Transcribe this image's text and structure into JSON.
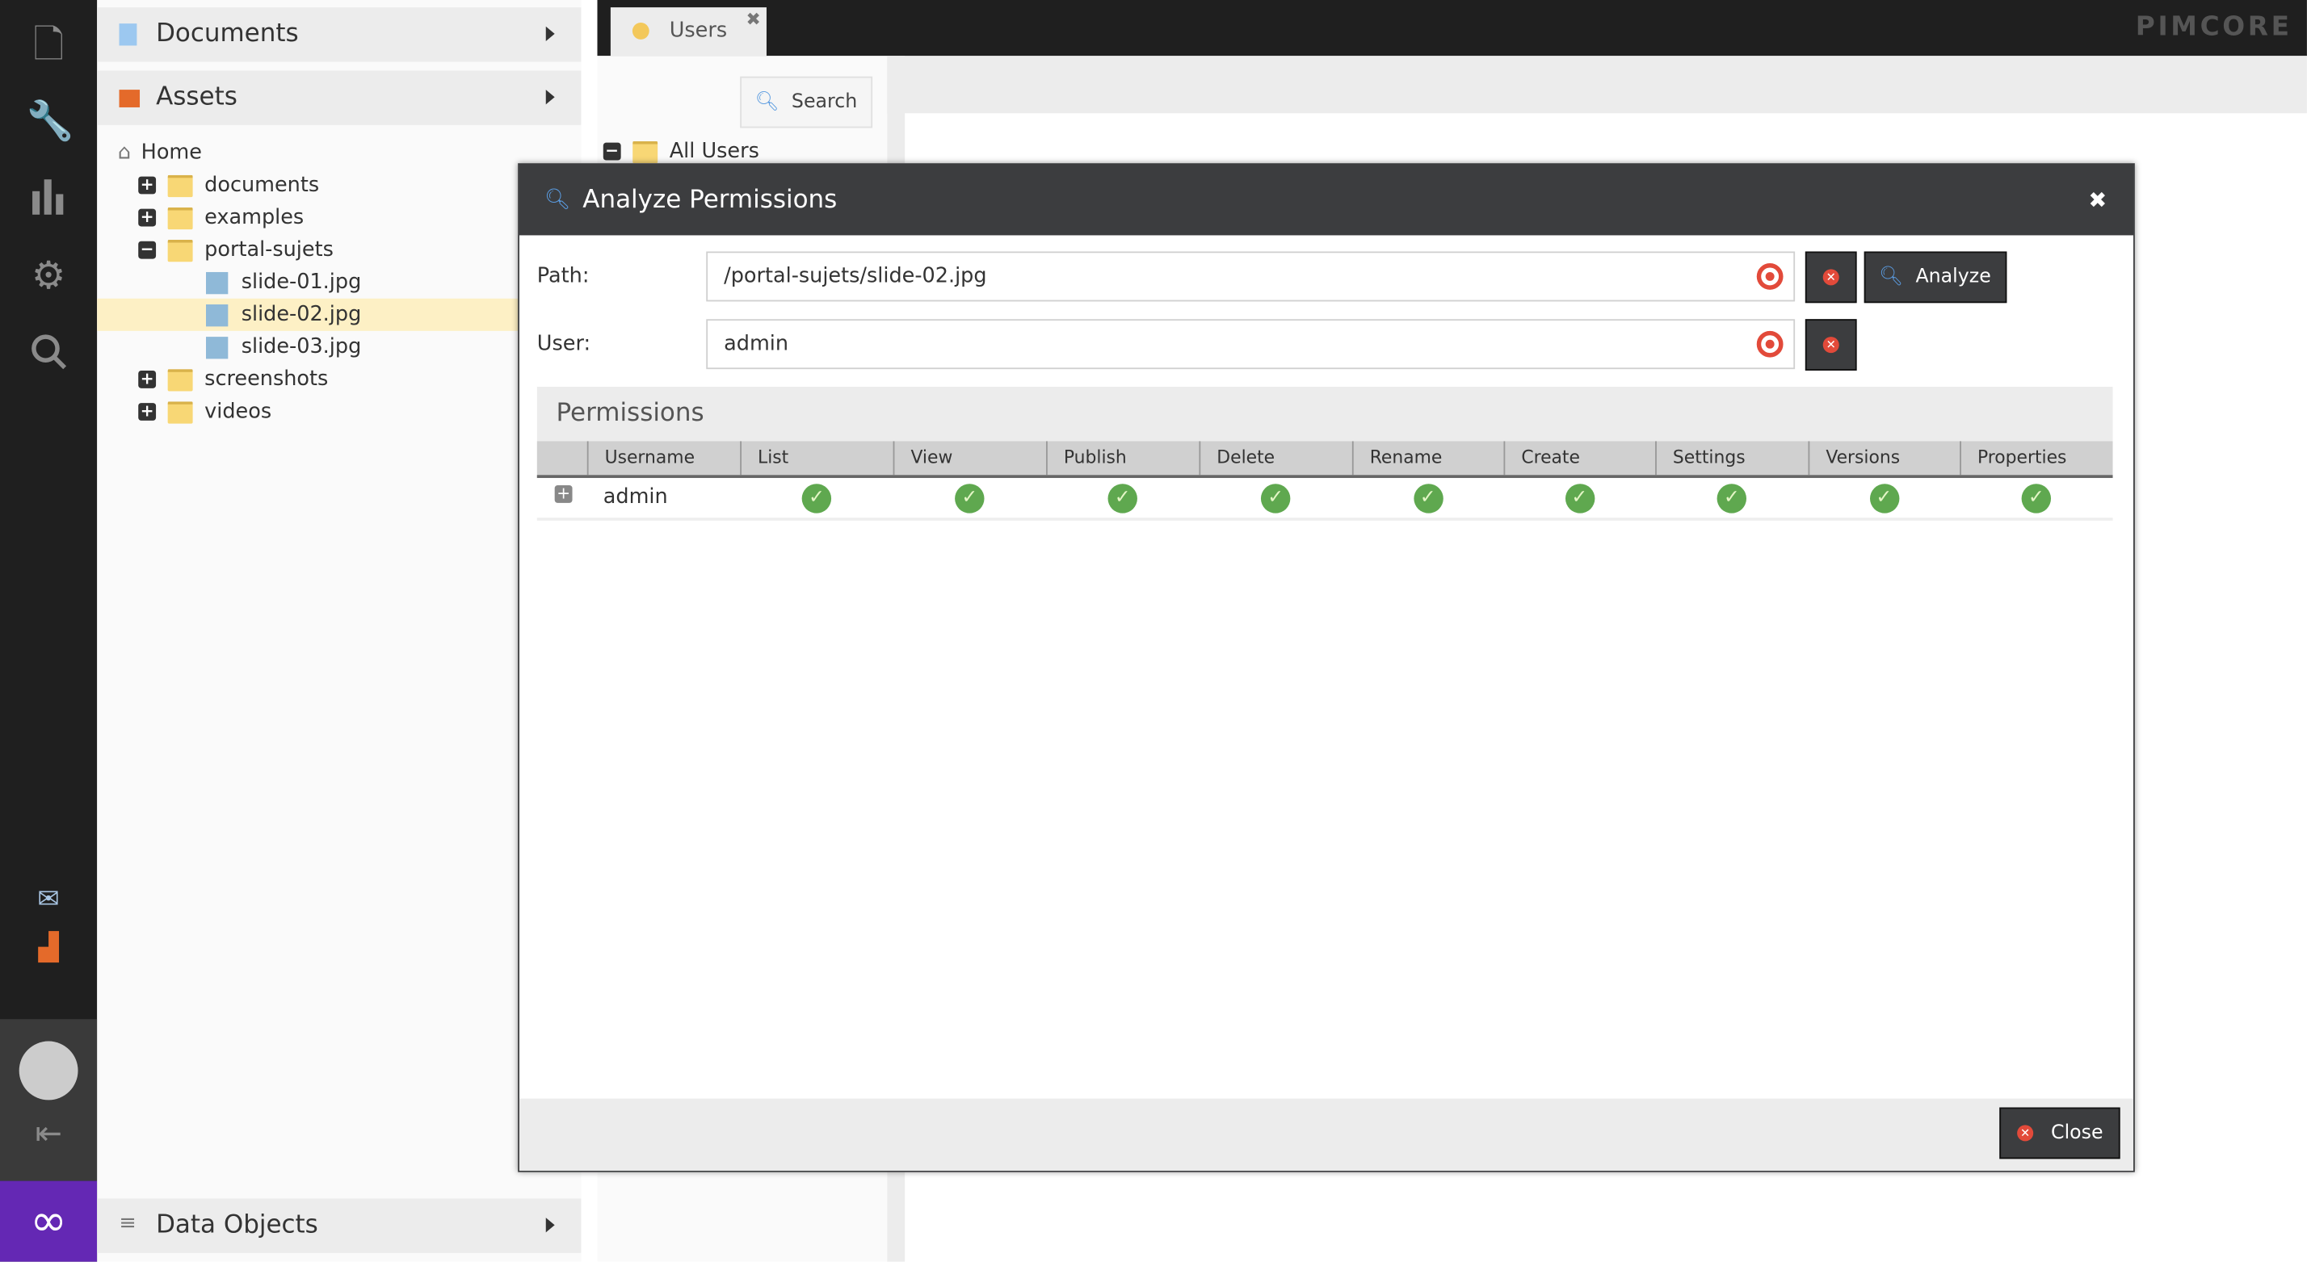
{
  "sidebar": {
    "icons": [
      "file-icon",
      "wrench-icon",
      "bar-chart-icon",
      "gear-icon",
      "search-icon",
      "mail-icon",
      "factory-icon",
      "avatar",
      "logout-icon",
      "pimcore-logo"
    ]
  },
  "tree_panel": {
    "documents_label": "Documents",
    "assets_label": "Assets",
    "data_objects_label": "Data Objects",
    "nodes": [
      {
        "label": "Home",
        "type": "home"
      },
      {
        "label": "documents",
        "type": "folder",
        "state": "collapsed"
      },
      {
        "label": "examples",
        "type": "folder",
        "state": "collapsed"
      },
      {
        "label": "portal-sujets",
        "type": "folder",
        "state": "expanded"
      },
      {
        "label": "slide-01.jpg",
        "type": "image"
      },
      {
        "label": "slide-02.jpg",
        "type": "image",
        "selected": true
      },
      {
        "label": "slide-03.jpg",
        "type": "image"
      },
      {
        "label": "screenshots",
        "type": "folder",
        "state": "collapsed"
      },
      {
        "label": "videos",
        "type": "folder",
        "state": "collapsed"
      }
    ]
  },
  "tabs": [
    {
      "label": "Users",
      "closable": true
    }
  ],
  "brand": "PIMCORE",
  "users_panel": {
    "search_label": "Search",
    "root_label": "All Users"
  },
  "dialog": {
    "title": "Analyze Permissions",
    "path_label": "Path:",
    "path_value": "/portal-sujets/slide-02.jpg",
    "user_label": "User:",
    "user_value": "admin",
    "analyze_label": "Analyze",
    "permissions_title": "Permissions",
    "columns": [
      "Username",
      "List",
      "View",
      "Publish",
      "Delete",
      "Rename",
      "Create",
      "Settings",
      "Versions",
      "Properties"
    ],
    "rows": [
      {
        "username": "admin",
        "permissions": [
          true,
          true,
          true,
          true,
          true,
          true,
          true,
          true,
          true
        ]
      }
    ],
    "close_label": "Close"
  },
  "colors": {
    "accent": "#6428b4",
    "dialog_header": "#3c3d3f",
    "check": "#5fa84f",
    "selected_row": "#fdf0c5",
    "danger": "#e24a3a"
  }
}
